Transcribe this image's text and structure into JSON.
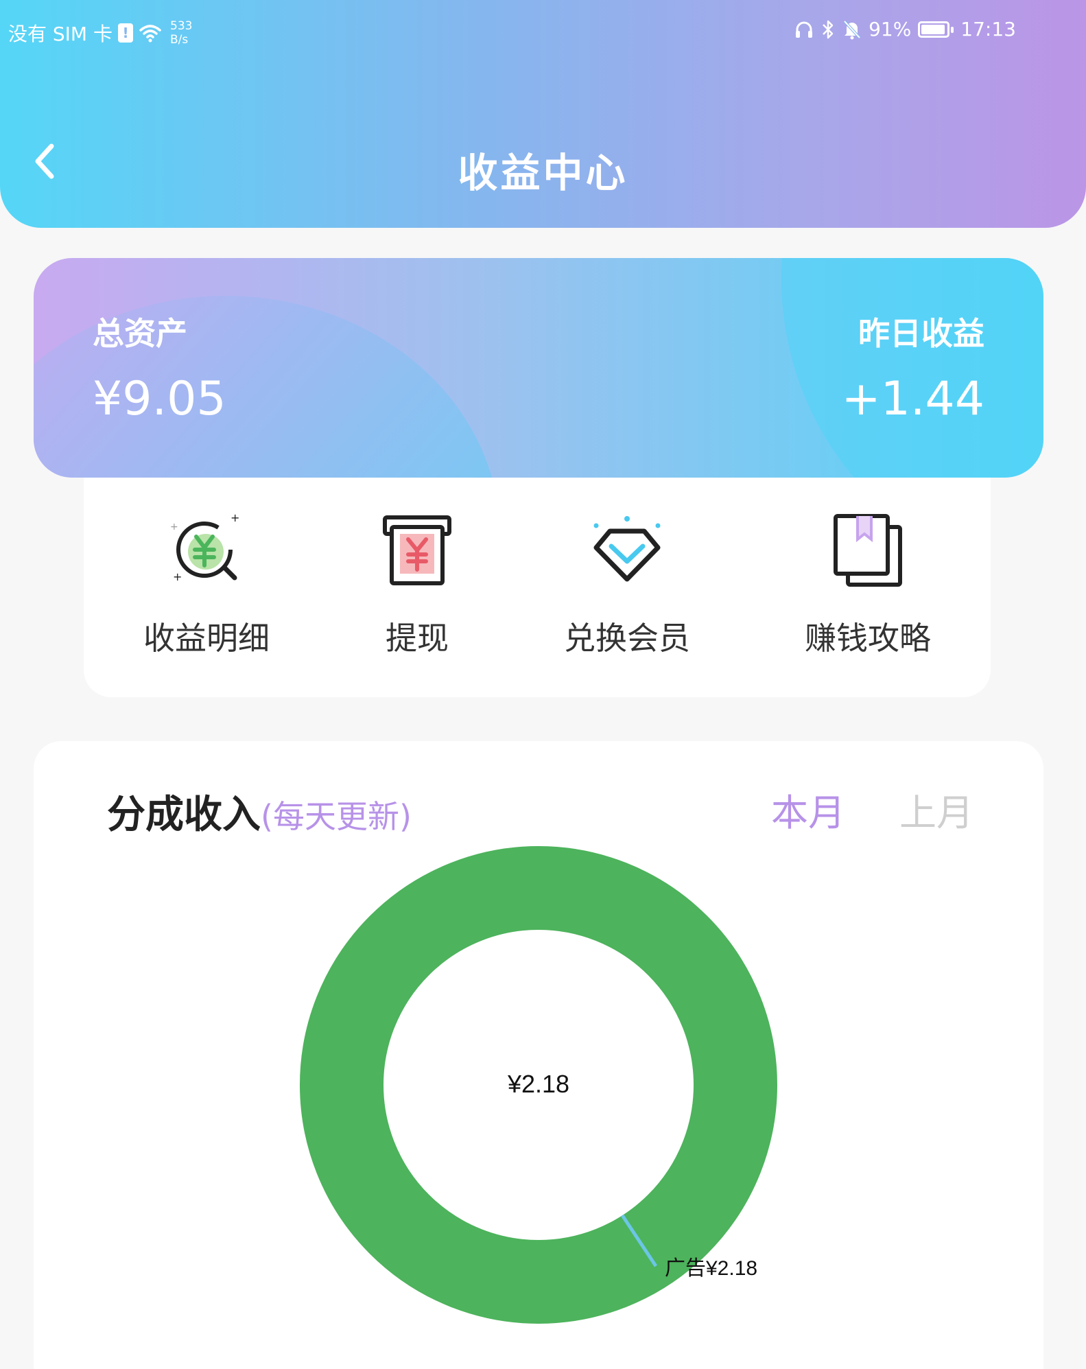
{
  "status_bar": {
    "carrier": "没有 SIM 卡",
    "sim_alert": "!",
    "net_speed_value": "533",
    "net_speed_unit": "B/s",
    "battery_percent": "91%",
    "time": "17:13"
  },
  "header": {
    "title": "收益中心"
  },
  "assets": {
    "total_label": "总资产",
    "total_value": "¥9.05",
    "yesterday_label": "昨日收益",
    "yesterday_value": "+1.44"
  },
  "actions": [
    {
      "label": "收益明细",
      "icon": "earnings-detail-icon"
    },
    {
      "label": "提现",
      "icon": "withdraw-icon"
    },
    {
      "label": "兑换会员",
      "icon": "diamond-icon"
    },
    {
      "label": "赚钱攻略",
      "icon": "guide-book-icon"
    }
  ],
  "income": {
    "title": "分成收入",
    "subtitle": "(每天更新)",
    "tab_this_month": "本月",
    "tab_last_month": "上月"
  },
  "chart_data": {
    "type": "pie",
    "center_label": "¥2.18",
    "slices": [
      {
        "label": "广告¥2.18",
        "value": 2.18,
        "color": "#4db35c"
      }
    ],
    "colors": {
      "ring": "#4db35c",
      "leader_line": "#6cc6e6"
    }
  },
  "colors": {
    "accent_purple": "#b792e8",
    "header_start": "#55d6f7",
    "header_end": "#bb95e6"
  }
}
